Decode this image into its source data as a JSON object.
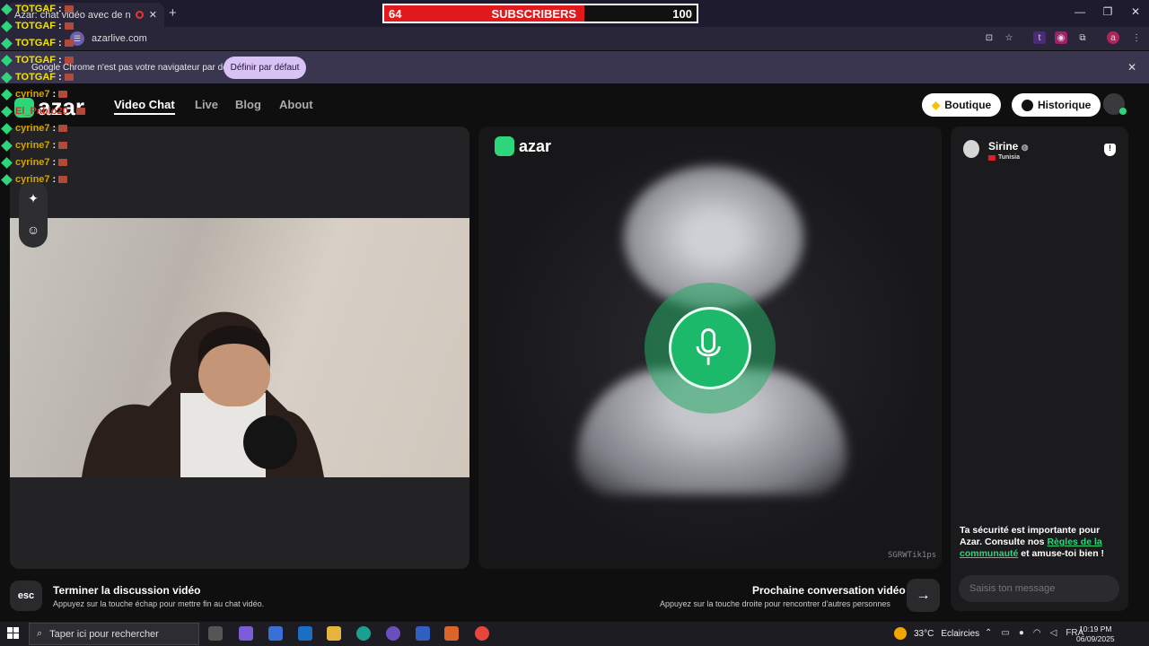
{
  "browser": {
    "tab_title": "Azar: chat vidéo avec de n",
    "url": "azarlive.com",
    "infobar_text": "Google Chrome n'est pas votre navigateur par défaut",
    "infobar_button": "Définir par défaut"
  },
  "overlay": {
    "subscribers_current": "64",
    "subscribers_label": "SUBSCRIBERS",
    "subscribers_goal": "100",
    "progress_fraction": 0.64,
    "chat": [
      {
        "user": "TOTGAF",
        "sep": ":"
      },
      {
        "user": "TOTGAF",
        "sep": ":"
      },
      {
        "user": "TOTGAF",
        "sep": ":"
      },
      {
        "user": "TOTGAF",
        "sep": ":"
      },
      {
        "user": "TOTGAF",
        "sep": ":"
      },
      {
        "user": "cyrine7",
        "sep": ":"
      },
      {
        "user": "El_Pablo20",
        "sep": ":"
      },
      {
        "user": "cyrine7",
        "sep": ":"
      },
      {
        "user": "cyrine7",
        "sep": ":"
      },
      {
        "user": "cyrine7",
        "sep": ":"
      },
      {
        "user": "cyrine7",
        "sep": ":"
      }
    ]
  },
  "site": {
    "logo": "azar",
    "nav": {
      "video_chat": "Video Chat",
      "live": "Live",
      "blog": "Blog",
      "about": "About"
    },
    "boutique": "Boutique",
    "historique": "Historique"
  },
  "partner": {
    "name": "Sirine",
    "country": "Tunisia",
    "session_id": "SGRWTik1ps"
  },
  "chat_panel": {
    "safety_prefix": "Ta sécurité est importante pour Azar. Consulte nos ",
    "safety_link": "Règles de la communauté",
    "safety_suffix": " et amuse-toi bien !",
    "input_placeholder": "Saisis ton message"
  },
  "controls": {
    "esc_label": "esc",
    "end_title": "Terminer la discussion vidéo",
    "end_sub": "Appuyez sur la touche échap pour mettre fin au chat vidéo.",
    "next_title": "Prochaine conversation vidéo",
    "next_sub": "Appuyez sur la touche droite pour rencontrer d'autres personnes",
    "next_arrow": "→"
  },
  "taskbar": {
    "search_placeholder": "Taper ici pour rechercher",
    "temperature": "33°C",
    "weather": "Eclaircies",
    "language": "FRA",
    "time": "10:19 PM",
    "date": "06/09/2025"
  },
  "colors": {
    "accent": "#2dd67a",
    "sub_bar": "#e0191c",
    "background": "#0f0f10"
  }
}
